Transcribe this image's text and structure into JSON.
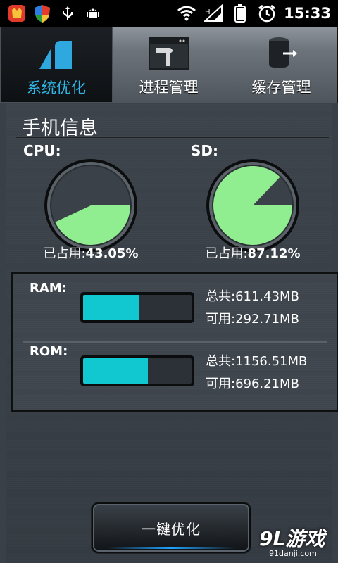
{
  "status_bar": {
    "time": "15:33",
    "icons": [
      "app-red-icon",
      "shield-icon",
      "usb-icon",
      "android-icon",
      "wifi-icon",
      "signal-icon",
      "battery-icon",
      "alarm-icon"
    ]
  },
  "tabs": [
    {
      "label": "系统优化",
      "icon": "bar-chart-icon",
      "active": true
    },
    {
      "label": "进程管理",
      "icon": "hammer-window-icon",
      "active": false
    },
    {
      "label": "缓存管理",
      "icon": "cylinder-arrow-icon",
      "active": false
    }
  ],
  "phone_info": {
    "title": "手机信息",
    "cpu": {
      "label": "CPU:",
      "caption_prefix": "已占用:",
      "value": "43.05%",
      "fraction": 0.4305
    },
    "sd": {
      "label": "SD:",
      "caption_prefix": "已占用:",
      "value": "87.12%",
      "fraction": 0.8712
    }
  },
  "memory": {
    "ram": {
      "label": "RAM:",
      "total": "总共:611.43MB",
      "available": "可用:292.71MB",
      "used_fraction": 0.52
    },
    "rom": {
      "label": "ROM:",
      "total": "总共:1156.51MB",
      "available": "可用:696.21MB",
      "used_fraction": 0.6
    }
  },
  "optimize_button": {
    "label": "一键优化"
  },
  "watermark": {
    "main": "9L游戏",
    "sub": "91danji.com"
  },
  "colors": {
    "accent_blue": "#2fb8e8",
    "gauge_green": "#90ee90",
    "bar_cyan": "#12c8d0"
  }
}
